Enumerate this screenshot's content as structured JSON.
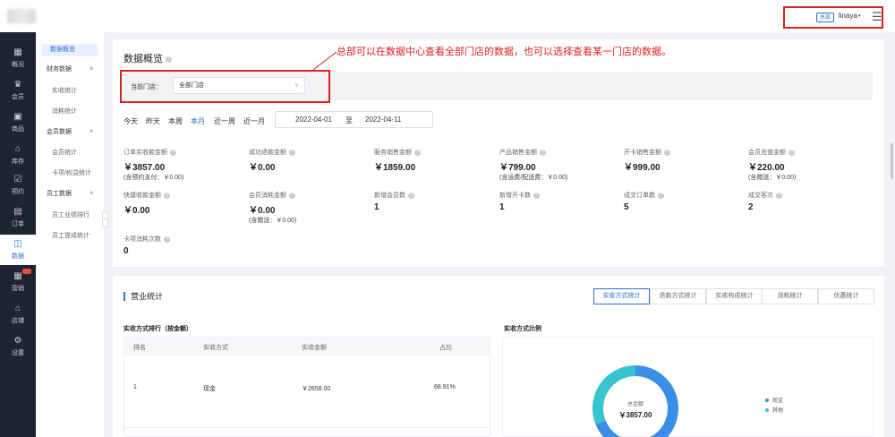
{
  "header": {
    "user_role_badge": "总部",
    "username": "linaya",
    "caret": "▾",
    "menu_glyph": "☰"
  },
  "sidebar": {
    "items": [
      {
        "label": "概况",
        "icon": "grid-icon",
        "glyph": "▦"
      },
      {
        "label": "会员",
        "icon": "crown-icon",
        "glyph": "♛"
      },
      {
        "label": "商品",
        "icon": "box-icon",
        "glyph": "▣"
      },
      {
        "label": "库存",
        "icon": "warehouse-icon",
        "glyph": "⌂"
      },
      {
        "label": "预约",
        "icon": "calendar-check-icon",
        "glyph": "☑"
      },
      {
        "label": "订单",
        "icon": "order-icon",
        "glyph": "▤"
      },
      {
        "label": "数据",
        "icon": "chart-icon",
        "glyph": "◫"
      },
      {
        "label": "营销",
        "icon": "shop-bag-icon",
        "glyph": "▦"
      },
      {
        "label": "店铺",
        "icon": "store-icon",
        "glyph": "⌂"
      },
      {
        "label": "设置",
        "icon": "gear-icon",
        "glyph": "⚙"
      }
    ],
    "active_index": 6
  },
  "submenu": {
    "overview": "数据概览",
    "finance_group": "财务数据",
    "finance_items": [
      "实收统计",
      "消耗统计"
    ],
    "member_group": "会员数据",
    "member_items": [
      "会员统计",
      "卡项/权益统计"
    ],
    "staff_group": "员工数据",
    "staff_items": [
      "员工业绩排行",
      "员工提成统计"
    ],
    "caret_up": "∧",
    "collapse": "‹"
  },
  "page": {
    "title": "数据概览",
    "help": "?"
  },
  "annotation": "总部可以在数据中心查看全部门店的数据，也可以选择查看某一门店的数据。",
  "filter": {
    "label": "当前门店：",
    "selected": "全部门店",
    "chevron": "∨"
  },
  "date_tabs": [
    "今天",
    "昨天",
    "本周",
    "本月",
    "近一周",
    "近一月"
  ],
  "date_active_index": 3,
  "date_range": {
    "start": "2022-04-01",
    "sep": "至",
    "end": "2022-04-11"
  },
  "metrics": [
    {
      "label": "订单实收款金额",
      "value": "￥3857.00",
      "sub": "(含预约支付：￥0.00)"
    },
    {
      "label": "成功退款金额",
      "value": "￥0.00",
      "sub": ""
    },
    {
      "label": "服务销售金额",
      "value": "￥1859.00",
      "sub": ""
    },
    {
      "label": "产品销售金额",
      "value": "￥799.00",
      "sub": "(含运费/配送费：￥0.00)"
    },
    {
      "label": "开卡销售金额",
      "value": "￥999.00",
      "sub": ""
    },
    {
      "label": "会员充值金额",
      "value": "￥220.00",
      "sub": "(含赠送：￥0.00)"
    },
    {
      "label": "快捷收款金额",
      "value": "￥0.00",
      "sub": ""
    },
    {
      "label": "会员消耗金额",
      "value": "￥0.00",
      "sub": "(含赠送：￥0.00)"
    },
    {
      "label": "新增会员数",
      "value": "1",
      "sub": ""
    },
    {
      "label": "新增开卡数",
      "value": "1",
      "sub": ""
    },
    {
      "label": "成交订单数",
      "value": "5",
      "sub": ""
    },
    {
      "label": "成交客次",
      "value": "2",
      "sub": ""
    },
    {
      "label": "卡项消耗次数",
      "value": "0",
      "sub": ""
    }
  ],
  "revenue": {
    "title": "营业统计",
    "tabs": [
      "实收方式统计",
      "退款方式统计",
      "实收构成统计",
      "消耗统计",
      "优惠统计"
    ],
    "active_tab": 0,
    "table_title": "实收方式排行（按金额）",
    "columns": [
      "排名",
      "实收方式",
      "实收金额",
      "占比"
    ],
    "rows": [
      {
        "rank": "1",
        "method": "现金",
        "amount": "￥2658.00",
        "percent": "68.91%"
      }
    ],
    "pie_title": "实收方式比例",
    "pie_center_label": "总金额",
    "pie_center_value": "￥3857.00",
    "pie_segments": [
      {
        "name": "现金",
        "value": 2658.0,
        "color": "#3a8ee6"
      },
      {
        "name": "其他",
        "value": 1199.0,
        "color": "#36c5cf"
      }
    ]
  }
}
